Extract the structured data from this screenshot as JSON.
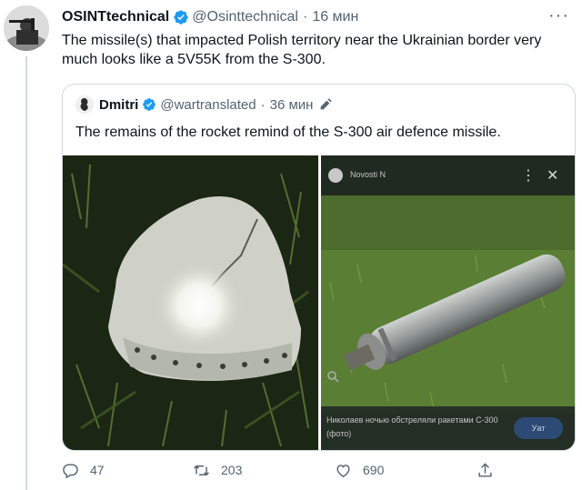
{
  "tweet": {
    "author_name": "OSINTtechnical",
    "author_handle": "@Osinttechnical",
    "separator": "·",
    "time": "16 мин",
    "more": "···",
    "text": "The missile(s) that impacted Polish territory near the Ukrainian border very much looks like a 5V55K from the S-300."
  },
  "quote": {
    "author_name": "Dmitri",
    "author_handle": "@wartranslated",
    "separator": "·",
    "time": "36 мин",
    "text": "The remains of the rocket remind of the S-300 air defence missile.",
    "media": {
      "right_source_name": "Novosti N",
      "right_source_menu": "⋮",
      "right_source_close": "✕",
      "right_caption": "Николаев ночью обстреляли ракетами С-300 (фото)",
      "right_caption_button": "Уат"
    }
  },
  "actions": {
    "reply_count": "47",
    "retweet_count": "203",
    "like_count": "690"
  },
  "colors": {
    "text_primary": "#0f1419",
    "text_secondary": "#536471",
    "verified": "#1d9bf0",
    "border": "#cfd9de"
  },
  "icons": [
    "verified-icon",
    "more-icon",
    "edit-pencil-icon",
    "reply-icon",
    "retweet-icon",
    "like-icon",
    "share-icon",
    "zoom-icon"
  ]
}
